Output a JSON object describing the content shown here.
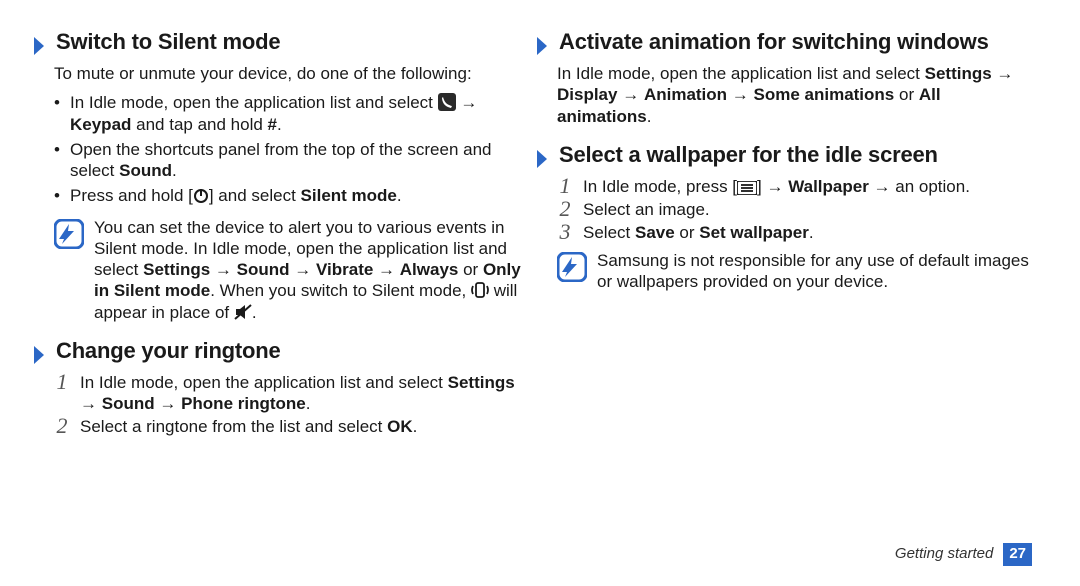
{
  "left": {
    "s1": {
      "title": "Switch to Silent mode",
      "lead": "To mute or unmute your device, do one of the following:",
      "b1a": "In Idle mode, open the application list and select ",
      "b1b": " → ",
      "b1c": "Keypad",
      "b1d": " and tap and hold ",
      "b1e": "#",
      "b1f": ".",
      "b2a": "Open the shortcuts panel from the top of the screen and select ",
      "b2b": "Sound",
      "b2c": ".",
      "b3a": "Press and hold [",
      "b3b": "] and select ",
      "b3c": "Silent mode",
      "b3d": ".",
      "note_a": "You can set the device to alert you to various events in Silent mode. In Idle mode, open the application list and select ",
      "note_b": "Settings",
      "note_c": " → ",
      "note_d": "Sound",
      "note_e": " → ",
      "note_f": "Vibrate",
      "note_g": " → ",
      "note_h": "Always",
      "note_i": " or ",
      "note_j": "Only in Silent mode",
      "note_k": ". When you switch to Silent mode, ",
      "note_l": " will appear in place of ",
      "note_m": "."
    },
    "s2": {
      "title": "Change your ringtone",
      "step1a": "In Idle mode, open the application list and select ",
      "step1b": "Settings",
      "step1c": " → ",
      "step1d": "Sound",
      "step1e": " → ",
      "step1f": "Phone ringtone",
      "step1g": ".",
      "step2a": "Select a ringtone from the list and select ",
      "step2b": "OK",
      "step2c": "."
    }
  },
  "right": {
    "s3": {
      "title": "Activate animation for switching windows",
      "p_a": "In Idle mode, open the application list and select ",
      "p_b": "Settings",
      "p_c": " → ",
      "p_d": "Display",
      "p_e": " → ",
      "p_f": "Animation",
      "p_g": " → ",
      "p_h": "Some animations",
      "p_i": " or ",
      "p_j": "All animations",
      "p_k": "."
    },
    "s4": {
      "title": "Select a wallpaper for the idle screen",
      "step1a": "In Idle mode, press [",
      "step1b": "] → ",
      "step1c": "Wallpaper",
      "step1d": " → an option.",
      "step2": "Select an image.",
      "step3a": "Select ",
      "step3b": "Save",
      "step3c": " or ",
      "step3d": "Set wallpaper",
      "step3e": ".",
      "note": "Samsung is not responsible for any use of default images or wallpapers provided on your device."
    }
  },
  "nums": {
    "n1": "1",
    "n2": "2",
    "n3": "3"
  },
  "footer": {
    "label": "Getting started",
    "page": "27"
  }
}
